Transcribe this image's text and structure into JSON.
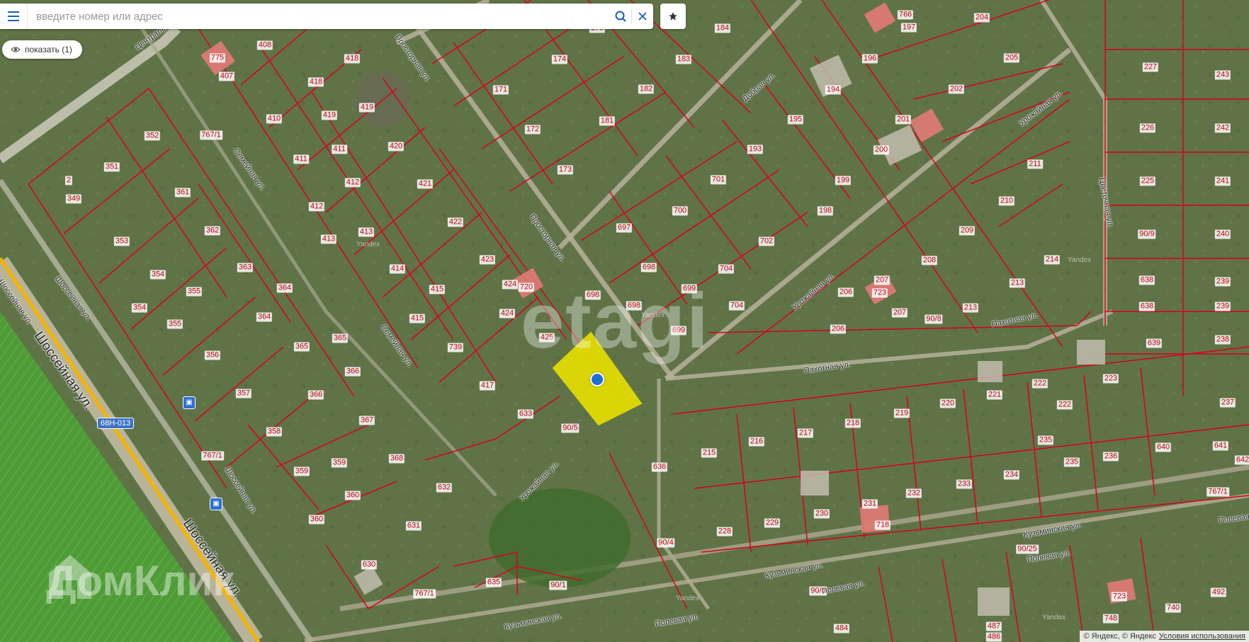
{
  "search": {
    "placeholder": "введите номер или адрес",
    "menu_icon": "hamburger-menu-icon",
    "search_icon": "search-icon",
    "clear_icon": "close-icon",
    "favorites_icon": "star-icon"
  },
  "filter": {
    "show_label": "показать (1)",
    "eye_icon": "eye-icon"
  },
  "route_badge": "68Н-013",
  "watermarks": {
    "etagi": "etagi",
    "domclick": "ДомКлик"
  },
  "attribution": {
    "text": "© Яндекс, © Яндекс",
    "link": "Условия использования"
  },
  "yandex_marks": [
    "Yandex",
    "Yandex",
    "Yandex",
    "Yandex",
    "Yandex"
  ],
  "colors": {
    "plot_border": "#d9001b",
    "selected_plot": "#e8e000",
    "marker": "#1f6fd1",
    "road": "#f5b400"
  },
  "plot_labels": [
    "775",
    "407",
    "408",
    "418",
    "418",
    "419",
    "410",
    "419",
    "411",
    "420",
    "411",
    "412",
    "421",
    "412",
    "413",
    "413",
    "422",
    "414",
    "423",
    "424",
    "720",
    "424",
    "415",
    "415",
    "425",
    "739",
    "417",
    "633",
    "90/5",
    "636",
    "632",
    "631",
    "630",
    "635",
    "90/1",
    "767/1",
    "767/1",
    "352",
    "767/1",
    "351",
    "2",
    "349",
    "361",
    "362",
    "353",
    "363",
    "354",
    "354",
    "355",
    "364",
    "364",
    "355",
    "356",
    "365",
    "365",
    "366",
    "357",
    "366",
    "367",
    "358",
    "368",
    "359",
    "359",
    "360",
    "360",
    "171",
    "172",
    "173",
    "174",
    "175",
    "183",
    "182",
    "181",
    "184",
    "697",
    "698",
    "698",
    "699",
    "699",
    "700",
    "701",
    "704",
    "704",
    "702",
    "698",
    "193",
    "195",
    "198",
    "199",
    "194",
    "196",
    "197",
    "200",
    "201",
    "202",
    "204",
    "205",
    "211",
    "210",
    "209",
    "208",
    "207",
    "723",
    "206",
    "207",
    "213",
    "213",
    "214",
    "206",
    "766",
    "90/8",
    "227",
    "226",
    "225",
    "243",
    "242",
    "241",
    "240",
    "90/9",
    "239",
    "239",
    "638",
    "638",
    "639",
    "238",
    "237",
    "223",
    "222",
    "221",
    "220",
    "219",
    "218",
    "216",
    "215",
    "217",
    "222",
    "235",
    "236",
    "235",
    "234",
    "233",
    "232",
    "231",
    "230",
    "229",
    "228",
    "90/4",
    "718",
    "640",
    "641",
    "642",
    "767/1",
    "90/25",
    "90/3",
    "484",
    "486",
    "487",
    "748",
    "740",
    "723",
    "492"
  ],
  "street_labels": [
    "Центральная ул.",
    "Просторная ул.",
    "Добрая ул.",
    "Семейная ул.",
    "Семейная ул.",
    "Просторная ул.",
    "Урожайная ул.",
    "Урожайная ул.",
    "Урожайная ул.",
    "Пахотная ул.",
    "Пахотная ул.",
    "Полевая ул.",
    "Кузьминская ул.",
    "Кузьминская ул.",
    "Кузьминская ул.",
    "Полевая ул.",
    "Полевая ул.",
    "Полевая ул.",
    "Шоссейная ул.",
    "Шоссейная ул.",
    "Шоссейная ул.",
    "Шоссейная ул.",
    "Шоссейная ул.",
    "Цветочная ул."
  ]
}
